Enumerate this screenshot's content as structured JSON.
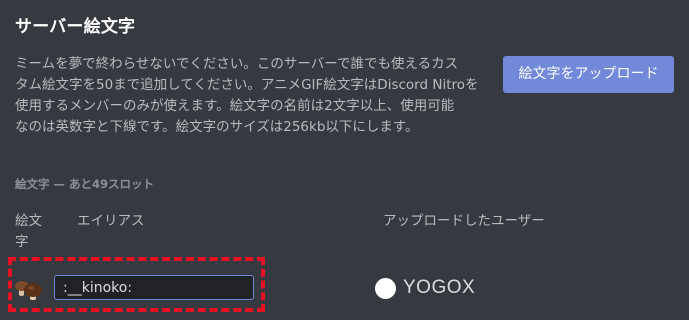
{
  "page": {
    "title": "サーバー絵文字",
    "description": "ミームを夢で終わらせないでください。このサーバーで誰でも使えるカス\nタム絵文字を50まで追加してください。アニメGIF絵文字はDiscord Nitroを\n使用するメンバーのみが使えます。絵文字の名前は2文字以上、使用可能\nなのは英数字と下線です。絵文字のサイズは256kb以下にします。",
    "upload_button_label": "絵文字をアップロード",
    "slots_header": "絵文字 — あと49スロット"
  },
  "columns": {
    "emoji": "絵文字",
    "alias": "エイリアス",
    "uploader": "アップロードしたユーザー"
  },
  "emojis": [
    {
      "icon": "mushroom-icon",
      "alias": ":__kinoko:",
      "uploader": "YOGOX"
    }
  ],
  "colors": {
    "background": "#36393f",
    "accent": "#7289da",
    "highlight": "#e81123"
  }
}
